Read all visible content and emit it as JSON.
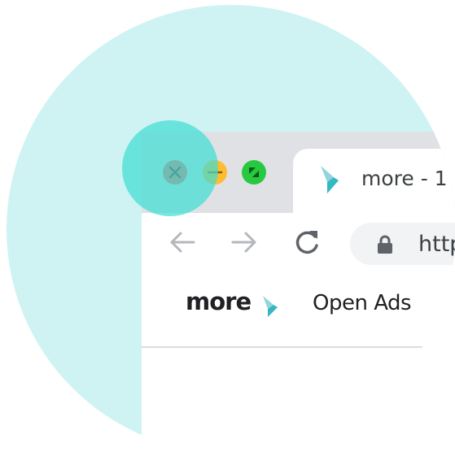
{
  "window_controls": {
    "close": {
      "icon": "close-icon",
      "color": "#ff5f57"
    },
    "minimize": {
      "icon": "minimize-icon",
      "color": "#febc2e"
    },
    "maximize": {
      "icon": "fullscreen-icon",
      "color": "#28c840"
    }
  },
  "tab": {
    "title": "more - 1",
    "favicon": "more-chevron-icon"
  },
  "toolbar": {
    "back_icon": "arrow-left-icon",
    "forward_icon": "arrow-right-icon",
    "reload_icon": "reload-icon",
    "url_text": "http",
    "lock_icon": "lock-icon"
  },
  "bookmarks": {
    "brand": "more",
    "brand_icon": "more-chevron-icon",
    "item_2": "Open Ads"
  },
  "colors": {
    "highlight": "#40ded4",
    "background_circle": "#cff3f3",
    "brand_teal": "#35b8c2",
    "tabbar": "#dfe1e5"
  }
}
